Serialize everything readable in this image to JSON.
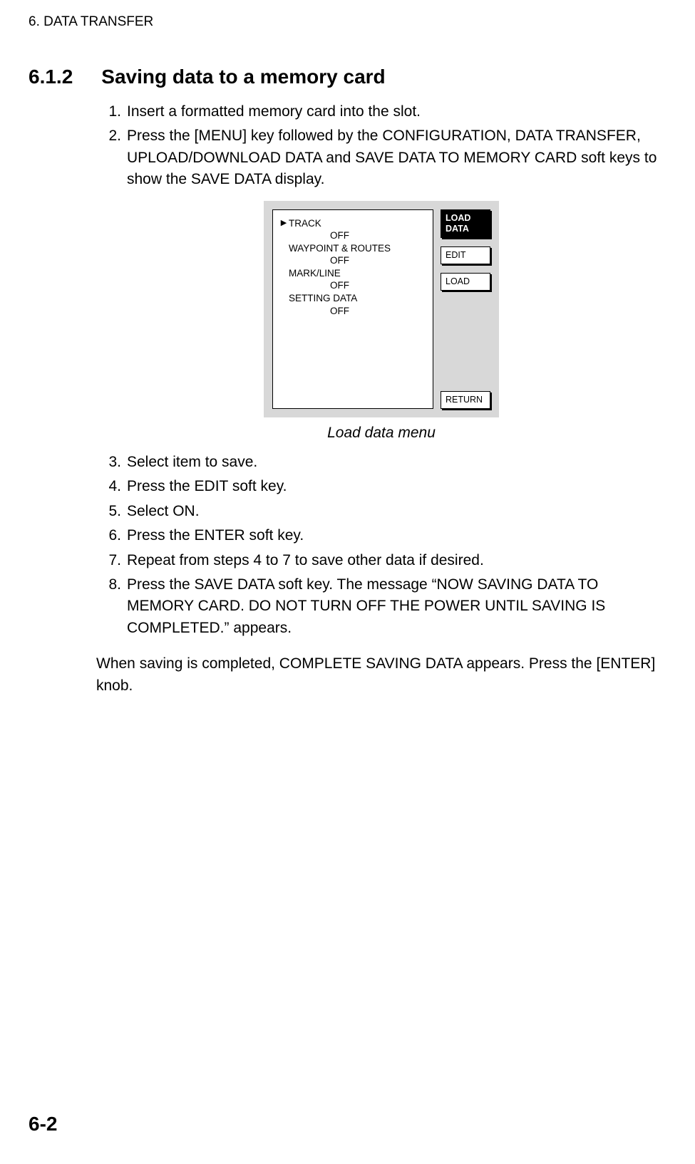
{
  "header": {
    "chapter": "6. DATA TRANSFER"
  },
  "section": {
    "number": "6.1.2",
    "title": "Saving data to a memory card"
  },
  "steps_a": [
    {
      "n": "1.",
      "t": "Insert a formatted memory card into the slot."
    },
    {
      "n": "2.",
      "t": "Press the [MENU] key followed by the CONFIGURATION, DATA TRANSFER, UPLOAD/DOWNLOAD DATA and SAVE DATA TO MEMORY CARD soft keys to show the SAVE DATA display."
    }
  ],
  "figure": {
    "caption": "Load data menu",
    "menu": {
      "items": [
        {
          "name": "TRACK",
          "value": "OFF",
          "cursor": true
        },
        {
          "name": "WAYPOINT & ROUTES",
          "value": "OFF",
          "cursor": false
        },
        {
          "name": "MARK/LINE",
          "value": "OFF",
          "cursor": false
        },
        {
          "name": "SETTING DATA",
          "value": "OFF",
          "cursor": false
        }
      ]
    },
    "softkeys": {
      "active": "LOAD\nDATA",
      "edit": "EDIT",
      "load": "LOAD",
      "return_": "RETURN"
    }
  },
  "steps_b": [
    {
      "n": "3.",
      "t": "Select item to save."
    },
    {
      "n": "4.",
      "t": "Press the EDIT soft key."
    },
    {
      "n": "5.",
      "t": "Select ON."
    },
    {
      "n": "6.",
      "t": "Press the ENTER soft key."
    },
    {
      "n": "7.",
      "t": "Repeat from steps 4 to 7 to save other data if desired."
    },
    {
      "n": "8.",
      "t": "Press the SAVE DATA soft key. The message “NOW SAVING DATA TO MEMORY CARD. DO NOT TURN OFF THE POWER UNTIL SAVING IS COMPLETED.” appears."
    }
  ],
  "closing": "When saving is completed, COMPLETE SAVING DATA appears. Press the [ENTER] knob.",
  "page_number": "6-2"
}
